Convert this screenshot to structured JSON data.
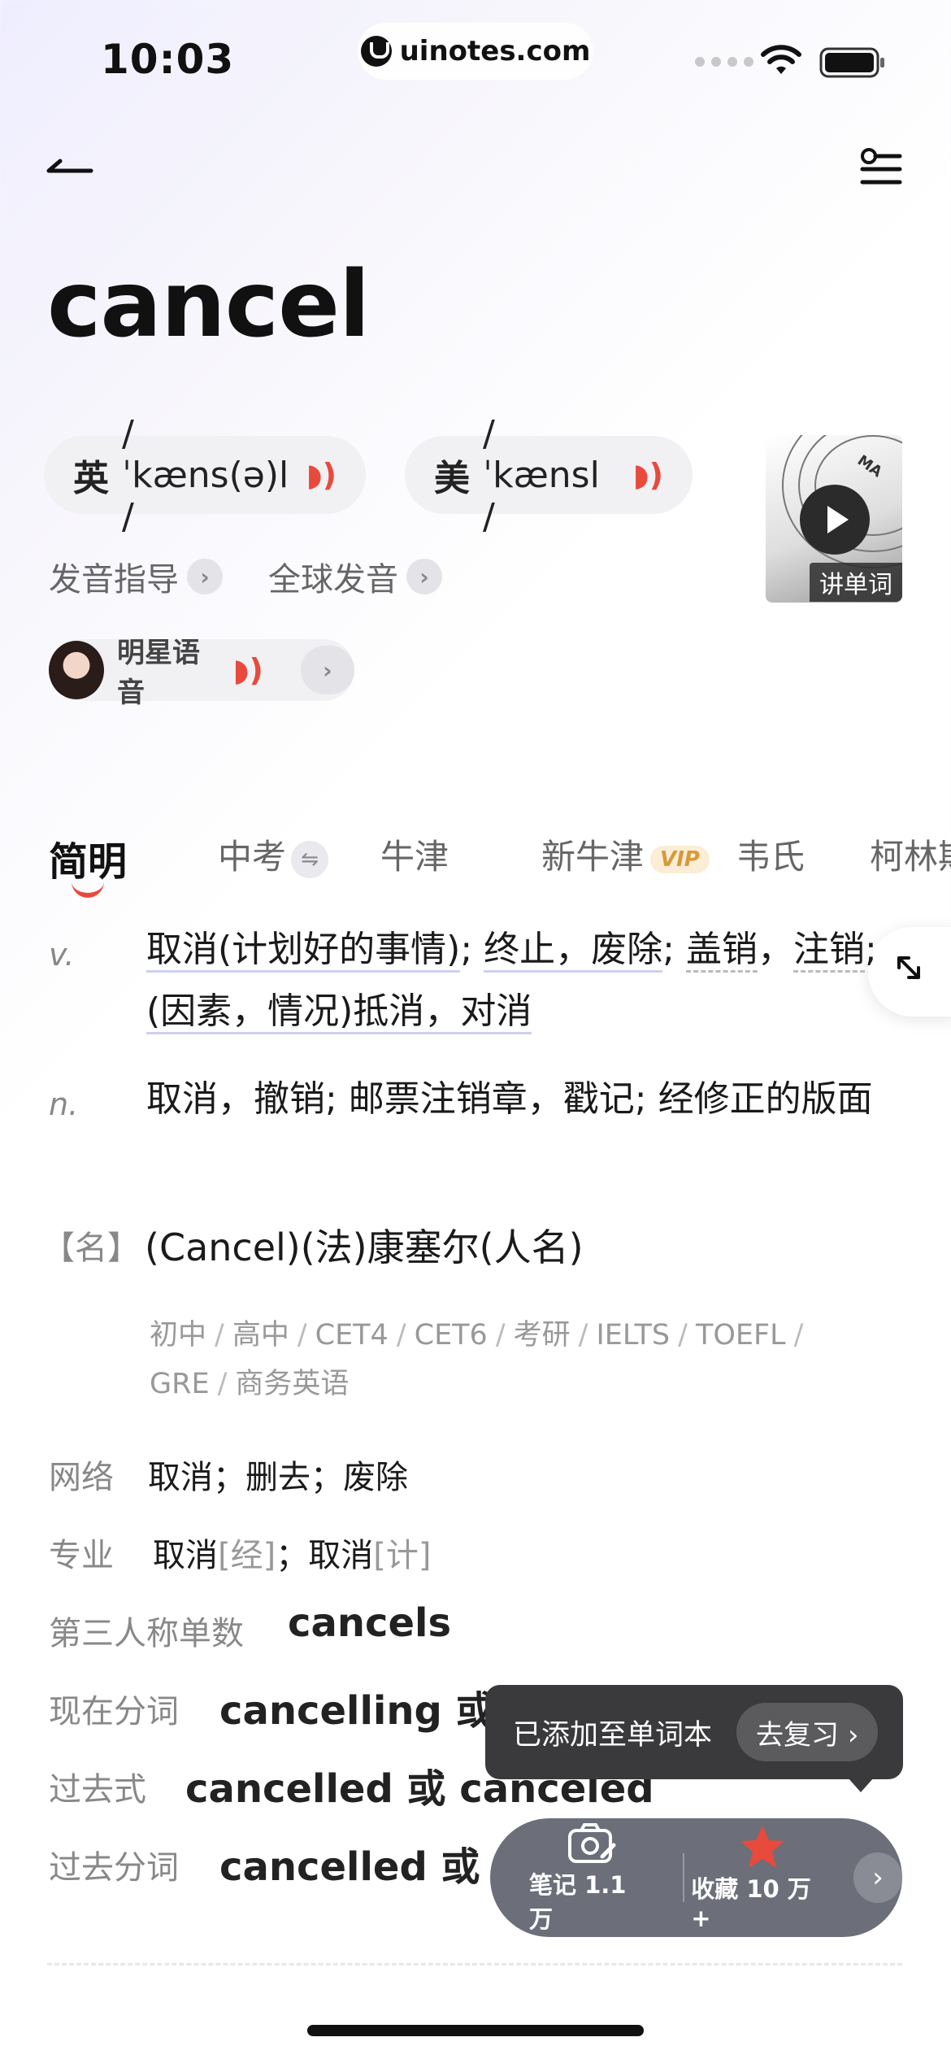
{
  "status_bar": {
    "time": "10:03",
    "url": "uinotes.com"
  },
  "word": "cancel",
  "pronunciations": [
    {
      "region": "英",
      "phonetic": "/ ˈkæns(ə)l /",
      "sound_icon": "sound-icon"
    },
    {
      "region": "美",
      "phonetic": "/ ˈkænsl /",
      "sound_icon": "sound-icon"
    }
  ],
  "video": {
    "label": "讲单词",
    "thumb_text": "MA"
  },
  "links": {
    "guide": "发音指导",
    "global": "全球发音",
    "celebrity": "明星语音"
  },
  "tabs": [
    {
      "label": "简明"
    },
    {
      "label": "中考"
    },
    {
      "label": "牛津"
    },
    {
      "label": "新牛津",
      "badge": "VIP"
    },
    {
      "label": "韦氏"
    },
    {
      "label": "柯林斯"
    }
  ],
  "definitions": {
    "v": {
      "pos": "v.",
      "parts": [
        "取消(计划好的事情)",
        "; ",
        "终止，废除",
        "; ",
        "盖销",
        "，",
        "注销",
        "; ",
        "(因素，情况)抵消，对消"
      ]
    },
    "n": {
      "pos": "n.",
      "text": "取消，撤销; 邮票注销章，戳记; 经修正的版面"
    },
    "name": {
      "label": "【名】",
      "text": "(Cancel)(法)康塞尔(人名)"
    }
  },
  "levels": [
    "初中",
    "高中",
    "CET4",
    "CET6",
    "考研",
    "IELTS",
    "TOEFL",
    "GRE",
    "商务英语"
  ],
  "level_sep": "/",
  "network": {
    "label": "网络",
    "text": "取消；删去；废除"
  },
  "professional": {
    "label": "专业",
    "items": [
      {
        "text": "取消",
        "tag": "[经]"
      },
      {
        "text": "取消",
        "tag": "[计]"
      }
    ],
    "sep": "；"
  },
  "inflections": [
    {
      "label": "第三人称单数",
      "value": "cancels"
    },
    {
      "label": "现在分词",
      "value": "cancelling 或 canceling"
    },
    {
      "label": "过去式",
      "value": "cancelled 或 canceled"
    },
    {
      "label": "过去分词",
      "value": "cancelled 或 canceled"
    }
  ],
  "toast": {
    "text": "已添加至单词本",
    "button": "去复习 ›"
  },
  "bottom_bar": {
    "note": "笔记 1.1 万",
    "collect": "收藏 10 万 +",
    "next": "›"
  },
  "colors": {
    "accent_red": "#e84a3c",
    "vip_gold": "#d79a3a",
    "toast_bg": "#3a3a3c",
    "bar_bg": "#6c6f7a"
  }
}
